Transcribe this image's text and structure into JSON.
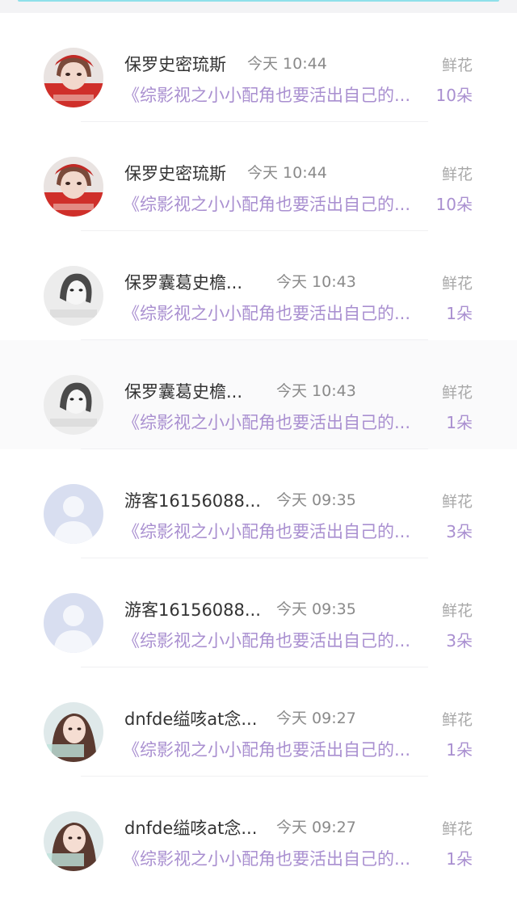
{
  "colors": {
    "name": "#333333",
    "time": "#8a8a8a",
    "accent": "#a98fd0",
    "gift": "#a8a8a8"
  },
  "rows": [
    {
      "avatar": "avatar-red-hat-girl",
      "name": "保罗史密琉斯",
      "time": "今天 10:44",
      "book": "《综影视之小小配角也要活出自己的...",
      "gift_label": "鲜花",
      "gift_count": "10朵"
    },
    {
      "avatar": "avatar-red-hat-girl",
      "name": "保罗史密琉斯",
      "time": "今天 10:44",
      "book": "《综影视之小小配角也要活出自己的...",
      "gift_label": "鲜花",
      "gift_count": "10朵"
    },
    {
      "avatar": "avatar-bw-girl",
      "name": "保罗囊葛史檐...",
      "time": "今天 10:43",
      "book": "《综影视之小小配角也要活出自己的...",
      "gift_label": "鲜花",
      "gift_count": "1朵"
    },
    {
      "avatar": "avatar-bw-girl",
      "name": "保罗囊葛史檐...",
      "time": "今天 10:43",
      "book": "《综影视之小小配角也要活出自己的...",
      "gift_label": "鲜花",
      "gift_count": "1朵"
    },
    {
      "avatar": "avatar-default-user",
      "name": "游客16156088...",
      "time": "今天 09:35",
      "book": "《综影视之小小配角也要活出自己的...",
      "gift_label": "鲜花",
      "gift_count": "3朵"
    },
    {
      "avatar": "avatar-default-user",
      "name": "游客16156088...",
      "time": "今天 09:35",
      "book": "《综影视之小小配角也要活出自己的...",
      "gift_label": "鲜花",
      "gift_count": "3朵"
    },
    {
      "avatar": "avatar-brown-hair-girl",
      "name": "dnfde缢咳at念...",
      "time": "今天 09:27",
      "book": "《综影视之小小配角也要活出自己的...",
      "gift_label": "鲜花",
      "gift_count": "1朵"
    },
    {
      "avatar": "avatar-brown-hair-girl",
      "name": "dnfde缢咳at念...",
      "time": "今天 09:27",
      "book": "《综影视之小小配角也要活出自己的...",
      "gift_label": "鲜花",
      "gift_count": "1朵"
    }
  ]
}
